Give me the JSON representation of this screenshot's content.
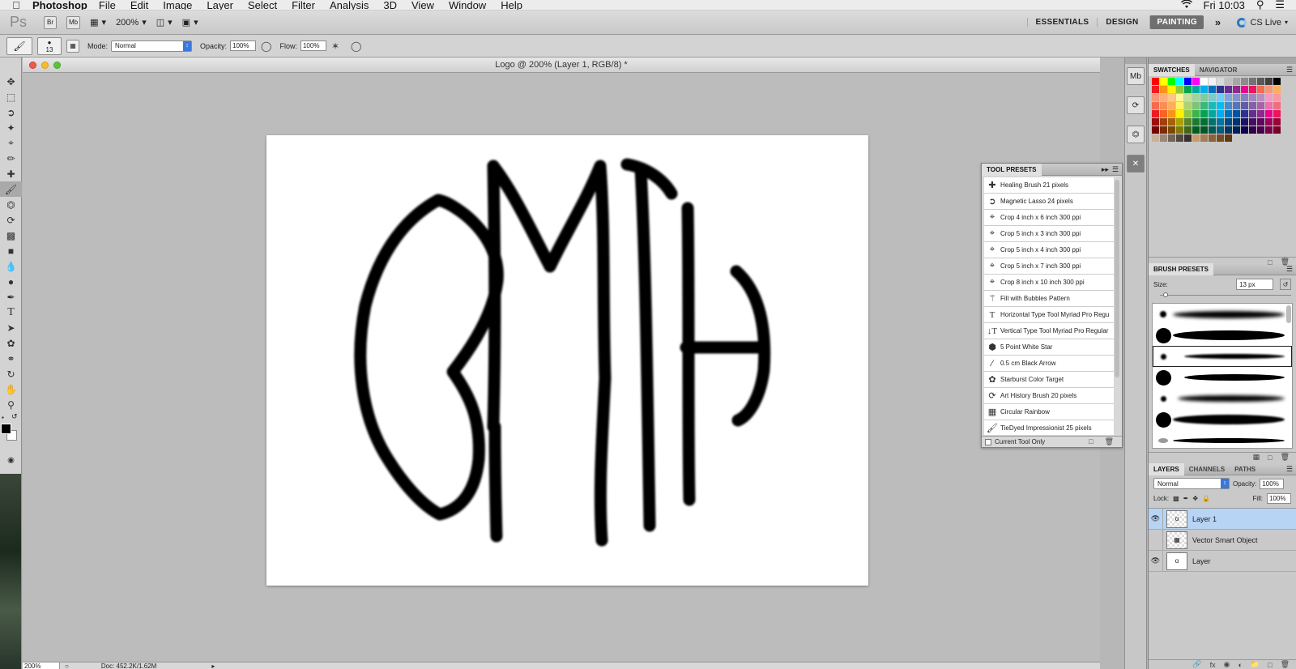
{
  "menubar": {
    "app_name": "Photoshop",
    "items": [
      "File",
      "Edit",
      "Image",
      "Layer",
      "Select",
      "Filter",
      "Analysis",
      "3D",
      "View",
      "Window",
      "Help"
    ],
    "clock": "Fri 10:03"
  },
  "appbar": {
    "logo": "Ps",
    "br": "Br",
    "mb": "Mb",
    "zoom": "200%",
    "workspaces": {
      "essentials": "ESSENTIALS",
      "design": "DESIGN",
      "painting": "PAINTING"
    },
    "more": "»",
    "cs_live": "CS Live"
  },
  "options": {
    "brush_size": "13",
    "mode_label": "Mode:",
    "mode_value": "Normal",
    "opacity_label": "Opacity:",
    "opacity_value": "100%",
    "flow_label": "Flow:",
    "flow_value": "100%"
  },
  "document": {
    "title": "Logo @ 200% (Layer 1, RGB/8) *",
    "status_zoom": "200%",
    "status_doc": "Doc: 452.2K/1.62M"
  },
  "tool_presets": {
    "title": "TOOL PRESETS",
    "items": [
      {
        "icon": "healing-brush-icon",
        "label": "Healing Brush 21 pixels"
      },
      {
        "icon": "magnetic-lasso-icon",
        "label": "Magnetic Lasso 24 pixels"
      },
      {
        "icon": "crop-icon",
        "label": "Crop 4 inch x 6 inch 300 ppi"
      },
      {
        "icon": "crop-icon",
        "label": "Crop 5 inch x 3 inch 300 ppi"
      },
      {
        "icon": "crop-icon",
        "label": "Crop 5 inch x 4 inch 300 ppi"
      },
      {
        "icon": "crop-icon",
        "label": "Crop 5 inch x 7 inch 300 ppi"
      },
      {
        "icon": "crop-icon",
        "label": "Crop 8 inch x 10 inch 300 ppi"
      },
      {
        "icon": "paint-bucket-icon",
        "label": "Fill with Bubbles Pattern"
      },
      {
        "icon": "horizontal-type-icon",
        "label": "Horizontal Type Tool Myriad Pro Regu"
      },
      {
        "icon": "vertical-type-icon",
        "label": "Vertical Type Tool Myriad Pro Regular"
      },
      {
        "icon": "polygon-icon",
        "label": "5 Point White Star"
      },
      {
        "icon": "line-icon",
        "label": "0.5 cm Black Arrow"
      },
      {
        "icon": "custom-shape-icon",
        "label": "Starburst Color Target"
      },
      {
        "icon": "art-history-brush-icon",
        "label": "Art History Brush 20 pixels"
      },
      {
        "icon": "gradient-icon",
        "label": "Circular Rainbow"
      },
      {
        "icon": "brush-icon",
        "label": "TieDyed Impressionist 25 pixels"
      }
    ],
    "current_tool_only": "Current Tool Only"
  },
  "swatches": {
    "tabs": [
      "SWATCHES",
      "NAVIGATOR"
    ],
    "colors": [
      "#ff0000",
      "#ffff00",
      "#00ff00",
      "#00ffff",
      "#0000ff",
      "#ff00ff",
      "#ffffff",
      "#f2f2f2",
      "#d9d9d9",
      "#bfbfbf",
      "#a6a6a6",
      "#8c8c8c",
      "#737373",
      "#595959",
      "#404040",
      "#000000",
      "#ed1c24",
      "#f7941d",
      "#fff200",
      "#8dc63f",
      "#00a651",
      "#00a99d",
      "#00aeef",
      "#0072bc",
      "#2e3192",
      "#662d91",
      "#92278f",
      "#ec008c",
      "#ed145b",
      "#f26c4f",
      "#f69679",
      "#fbaf5d",
      "#f7977a",
      "#f9ad81",
      "#fdc68a",
      "#fff79a",
      "#c4df9b",
      "#a3d39c",
      "#82ca9d",
      "#7accc8",
      "#6dcff6",
      "#7da7d9",
      "#8393ca",
      "#8781bd",
      "#a187be",
      "#bc8dbf",
      "#f49ac2",
      "#f6989d",
      "#f26c4f",
      "#f68e55",
      "#fbaf5c",
      "#fff467",
      "#acd372",
      "#7cc576",
      "#3bb878",
      "#1abbb4",
      "#00bff3",
      "#438cca",
      "#5574b9",
      "#605ca8",
      "#855fa8",
      "#a763a8",
      "#f06eaa",
      "#f26d7d",
      "#ed1c24",
      "#f26522",
      "#f7941d",
      "#fff200",
      "#8dc63f",
      "#39b54a",
      "#00a651",
      "#00a99d",
      "#00aeef",
      "#0072bc",
      "#0054a6",
      "#2e3192",
      "#662d91",
      "#92278f",
      "#ec008c",
      "#ed145b",
      "#9e0b0f",
      "#a0410d",
      "#a36209",
      "#aba000",
      "#598527",
      "#1a7b30",
      "#007236",
      "#00746b",
      "#0076a3",
      "#004b80",
      "#003471",
      "#1b1464",
      "#440e62",
      "#630460",
      "#9e005d",
      "#9e0039",
      "#790000",
      "#7b2e00",
      "#7d4900",
      "#827b00",
      "#406618",
      "#005e20",
      "#005826",
      "#005952",
      "#005b7f",
      "#003663",
      "#002157",
      "#0d004c",
      "#32004b",
      "#4b0049",
      "#7b0046",
      "#7a0026",
      "#c7b299",
      "#998675",
      "#736357",
      "#534741",
      "#37302d",
      "#c69c6d",
      "#a67c52",
      "#8c6239",
      "#754c24",
      "#603913"
    ]
  },
  "brush_presets": {
    "title": "BRUSH PRESETS",
    "size_label": "Size:",
    "size_value": "13 px"
  },
  "layers": {
    "tabs": [
      "LAYERS",
      "CHANNELS",
      "PATHS"
    ],
    "blend_mode": "Normal",
    "opacity_label": "Opacity:",
    "opacity_value": "100%",
    "lock_label": "Lock:",
    "fill_label": "Fill:",
    "fill_value": "100%",
    "items": [
      {
        "name": "Layer 1",
        "visible": true,
        "selected": true
      },
      {
        "name": "Vector Smart Object",
        "visible": false,
        "selected": false
      },
      {
        "name": "Layer",
        "visible": true,
        "selected": false
      }
    ]
  },
  "colors": {
    "selection": "#b7d4f5",
    "accent_blue": "#3b78d8",
    "close": "#ee5a52",
    "minimize": "#f5bd2f",
    "zoom": "#5dc43a"
  }
}
